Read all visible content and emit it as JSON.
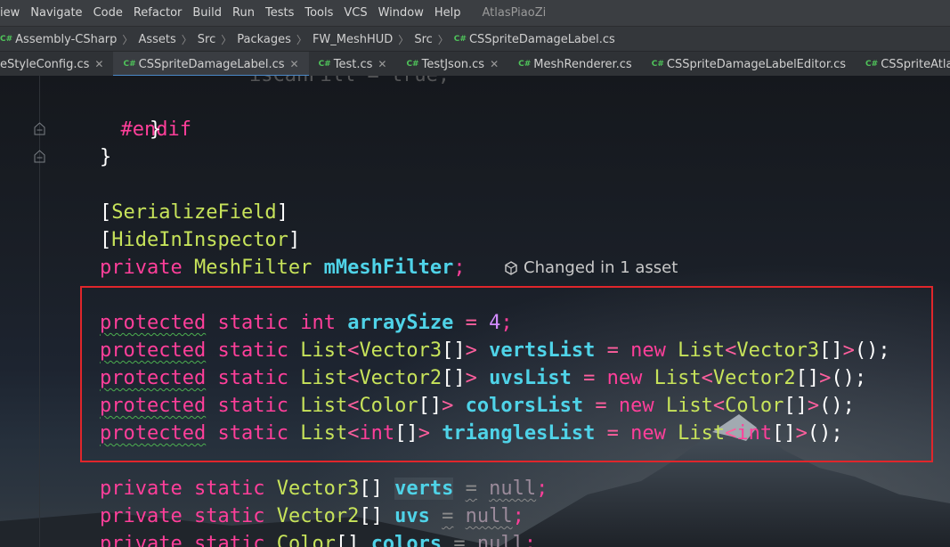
{
  "menu": {
    "items": [
      "iew",
      "Navigate",
      "Code",
      "Refactor",
      "Build",
      "Run",
      "Tests",
      "Tools",
      "VCS",
      "Window",
      "Help"
    ],
    "project_title": "AtlasPiaoZi"
  },
  "breadcrumb": [
    "Assembly-CSharp",
    "Assets",
    "Src",
    "Packages",
    "FW_MeshHUD",
    "Src",
    "CSSpriteDamageLabel.cs"
  ],
  "tabs": [
    {
      "label": "eStyleConfig.cs",
      "active": false
    },
    {
      "label": "CSSpriteDamageLabel.cs",
      "active": true
    },
    {
      "label": "Test.cs",
      "active": false
    },
    {
      "label": "TestJson.cs",
      "active": false
    },
    {
      "label": "MeshRenderer.cs",
      "active": false
    },
    {
      "label": "CSSpriteDamageLabelEditor.cs",
      "active": false
    },
    {
      "label": "CSSpriteAtlasChar.cs",
      "active": false
    }
  ],
  "icons": {
    "file_type": "csharp-file-icon",
    "tab_close": "close-icon",
    "fold": "fold-marker-icon",
    "unity": "unity-icon"
  },
  "colors": {
    "highlight_box": "#e0262b",
    "keyword": "#ff3f9a",
    "type": "#c7e35a",
    "identifier": "#4fd3e8",
    "number": "#d38cff"
  },
  "code": {
    "l0": {
      "text": "isCanFill = true;"
    },
    "l1": {
      "directive": "#endif"
    },
    "l2": {
      "brace": "}"
    },
    "l3": {
      "brace": "}"
    },
    "l4": {
      "open": "[",
      "attr": "SerializeField",
      "close": "]"
    },
    "l5": {
      "open": "[",
      "attr": "HideInInspector",
      "close": "]"
    },
    "l6": {
      "kw": "private",
      "type": "MeshFilter",
      "name": "mMeshFilter",
      "semi": ";"
    },
    "hint": "Changed in 1 asset",
    "l7": {
      "kw1": "protected",
      "kw2": "static",
      "type": "int",
      "name": "arraySize",
      "eq": "=",
      "value": "4",
      "semi": ";"
    },
    "l8": {
      "kw1": "protected",
      "kw2": "static",
      "t1": "List",
      "lt": "<",
      "t2": "Vector3",
      "br": "[]",
      "gt": ">",
      "name": "vertsList",
      "eq": "=",
      "new": "new",
      "t3": "List",
      "lt2": "<",
      "t4": "Vector3",
      "br2": "[]",
      "gt2": ">",
      "end": "();"
    },
    "l9": {
      "kw1": "protected",
      "kw2": "static",
      "t1": "List",
      "lt": "<",
      "t2": "Vector2",
      "br": "[]",
      "gt": ">",
      "name": "uvsList",
      "eq": "=",
      "new": "new",
      "t3": "List",
      "lt2": "<",
      "t4": "Vector2",
      "br2": "[]",
      "gt2": ">",
      "end": "();"
    },
    "l10": {
      "kw1": "protected",
      "kw2": "static",
      "t1": "List",
      "lt": "<",
      "t2": "Color",
      "br": "[]",
      "gt": ">",
      "name": "colorsList",
      "eq": "=",
      "new": "new",
      "t3": "List",
      "lt2": "<",
      "t4": "Color",
      "br2": "[]",
      "gt2": ">",
      "end": "();"
    },
    "l11": {
      "kw1": "protected",
      "kw2": "static",
      "t1": "List",
      "lt": "<",
      "t2": "int",
      "br": "[]",
      "gt": ">",
      "name": "trianglesList",
      "eq": "=",
      "new": "new",
      "t3": "List",
      "lt2": "<",
      "t4": "int",
      "br2": "[]",
      "gt2": ">",
      "end": "();"
    },
    "l12": {
      "kw1": "private",
      "kw2": "static",
      "type": "Vector3",
      "br": "[]",
      "name": "verts",
      "eq": "=",
      "null": "null",
      "semi": ";"
    },
    "l13": {
      "kw1": "private",
      "kw2": "static",
      "type": "Vector2",
      "br": "[]",
      "name": "uvs",
      "eq": "=",
      "null": "null",
      "semi": ";"
    },
    "l14": {
      "kw1": "private",
      "kw2": "static",
      "type": "Color",
      "br": "[]",
      "name": "colors",
      "eq": "=",
      "null": "null",
      "semi": ";"
    }
  }
}
